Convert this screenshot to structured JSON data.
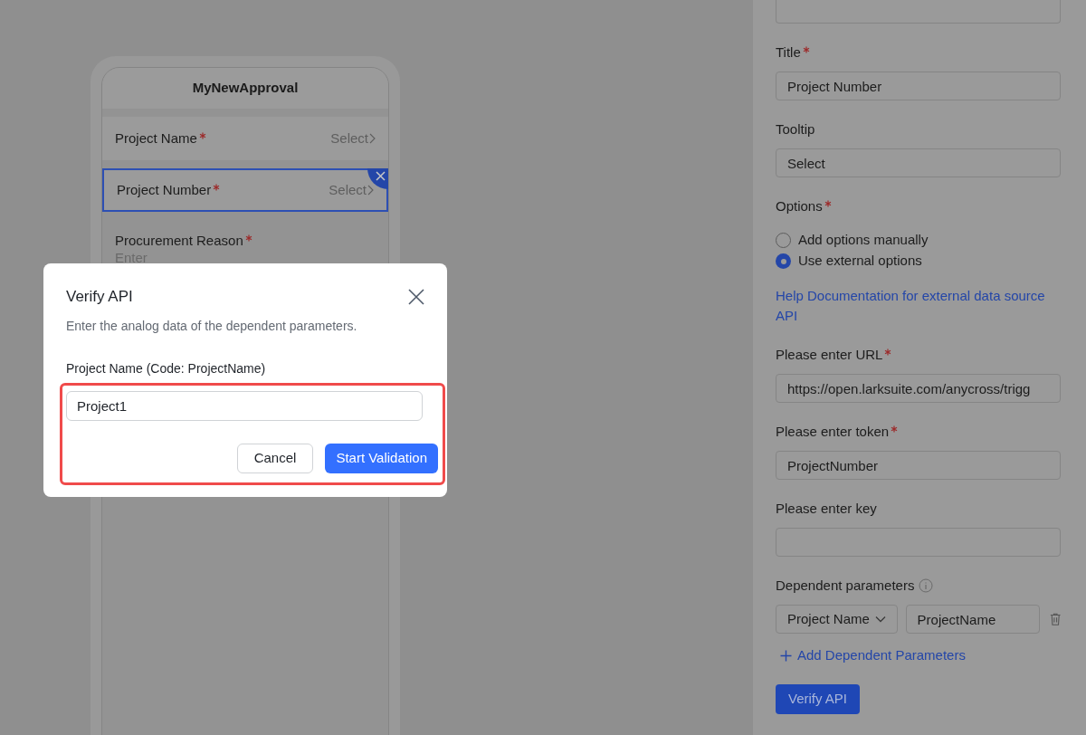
{
  "form_preview": {
    "title": "MyNewApproval",
    "fields": [
      {
        "kind": "select",
        "label": "Project Name",
        "required": true,
        "placeholder": "Select",
        "selected": false
      },
      {
        "kind": "select",
        "label": "Project Number",
        "required": true,
        "placeholder": "Select",
        "selected": true
      },
      {
        "kind": "text",
        "label": "Procurement Reason",
        "required": true,
        "placeholder": "Enter",
        "selected": false
      }
    ]
  },
  "properties": {
    "sections": [
      {
        "kind": "input",
        "label": "Title",
        "required": true,
        "value": "Project Number"
      },
      {
        "kind": "input",
        "label": "Tooltip",
        "required": false,
        "placeholder": "Select"
      },
      {
        "kind": "radio",
        "label": "Options",
        "required": true,
        "choices": [
          {
            "label": "Add options manually",
            "selected": false
          },
          {
            "label": "Use external options",
            "selected": true
          }
        ]
      },
      {
        "kind": "link",
        "text": "Help Documentation for external data source API"
      },
      {
        "kind": "input",
        "label": "Please enter URL",
        "required": true,
        "value": "https://open.larksuite.com/anycross/trigg"
      },
      {
        "kind": "input",
        "label": "Please enter token",
        "required": true,
        "value": "ProjectNumber"
      },
      {
        "kind": "input",
        "label": "Please enter key",
        "required": false
      },
      {
        "kind": "params",
        "label": "Dependent parameters",
        "required": false,
        "rows": [
          {
            "parameter": "Project Name",
            "code": "ProjectName"
          }
        ],
        "add_link": "Add Dependent Parameters"
      }
    ],
    "verify_button": "Verify API"
  },
  "dialog": {
    "title": "Verify API",
    "description": "Enter the analog data of the dependent parameters.",
    "field_label": "Project Name (Code: ProjectName)",
    "field_value": "Project1",
    "highlighted": true,
    "buttons": [
      {
        "kind": "secondary",
        "label": "Cancel"
      },
      {
        "kind": "primary",
        "label": "Start Validation"
      }
    ]
  }
}
